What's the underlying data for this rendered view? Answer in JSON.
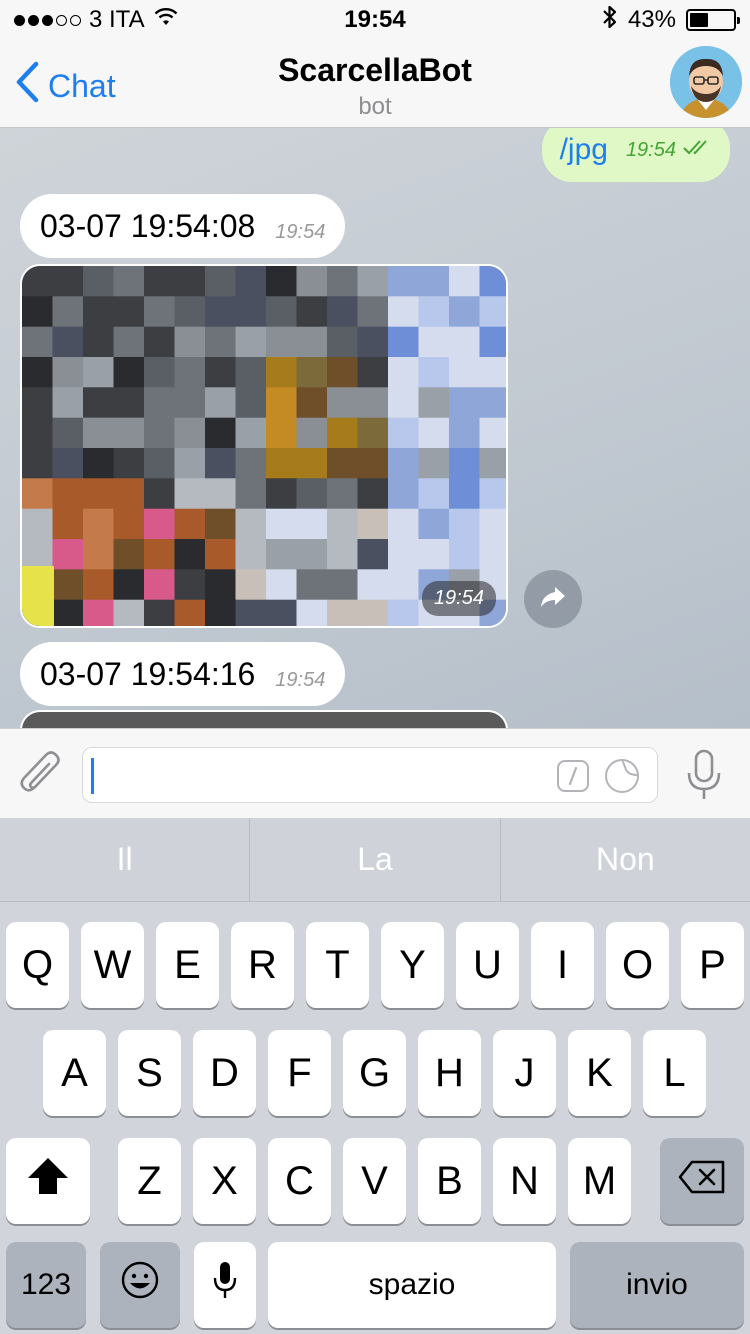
{
  "status": {
    "carrier": "3 ITA",
    "time": "19:54",
    "battery": "43%",
    "battery_fraction": 0.43
  },
  "nav": {
    "back_label": "Chat",
    "title": "ScarcellaBot",
    "subtitle": "bot"
  },
  "messages": {
    "outgoing": {
      "text": "/jpg",
      "time": "19:54"
    },
    "incoming1": {
      "text": "03-07 19:54:08",
      "time": "19:54"
    },
    "photo": {
      "time": "19:54"
    },
    "incoming2": {
      "text": "03-07 19:54:16",
      "time": "19:54"
    }
  },
  "keyboard": {
    "suggestions": [
      "Il",
      "La",
      "Non"
    ],
    "row1": [
      "Q",
      "W",
      "E",
      "R",
      "T",
      "Y",
      "U",
      "I",
      "O",
      "P"
    ],
    "row2": [
      "A",
      "S",
      "D",
      "F",
      "G",
      "H",
      "J",
      "K",
      "L"
    ],
    "row3": [
      "Z",
      "X",
      "C",
      "V",
      "B",
      "N",
      "M"
    ],
    "numbers_label": "123",
    "space_label": "spazio",
    "return_label": "invio"
  },
  "icons": {
    "status": [
      "wifi-icon",
      "bluetooth-icon",
      "battery-icon"
    ],
    "nav": [
      "chevron-left-icon",
      "bot-avatar"
    ],
    "input": [
      "paperclip-icon",
      "command-icon",
      "sticker-icon",
      "microphone-icon"
    ],
    "keyboard": [
      "shift-icon",
      "backspace-icon",
      "emoji-icon",
      "dictation-icon"
    ]
  },
  "colors": {
    "accent": "#1d7ef0",
    "outgoing_bubble": "#dff8c6",
    "incoming_bubble": "#ffffff",
    "read_check": "#44a532"
  }
}
